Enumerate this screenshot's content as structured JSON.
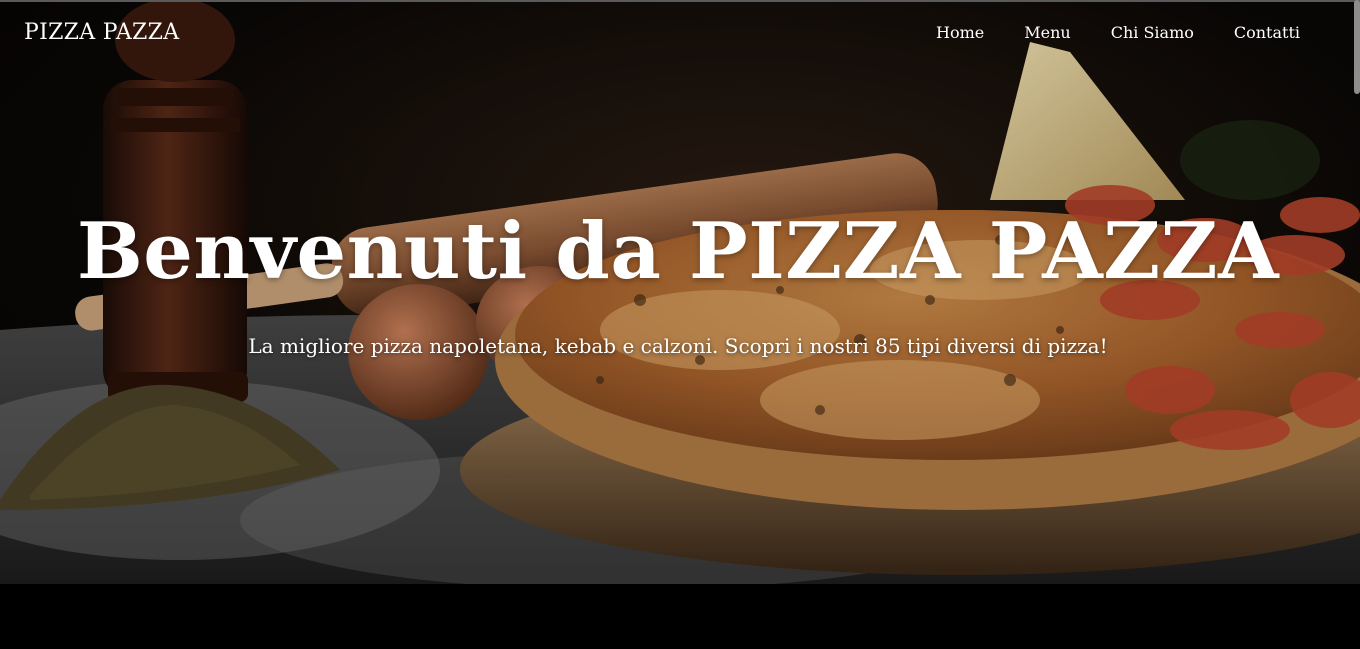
{
  "header": {
    "brand": "PIZZA PAZZA",
    "nav": [
      "Home",
      "Menu",
      "Chi Siamo",
      "Contatti"
    ]
  },
  "hero": {
    "title": "Benvenuti da PIZZA PAZZA",
    "subtitle": "La migliore pizza napoletana, kebab e calzoni. Scopri i nostri 85 tipi diversi di pizza!"
  },
  "colors": {
    "text": "#ffffff",
    "background": "#000000"
  }
}
